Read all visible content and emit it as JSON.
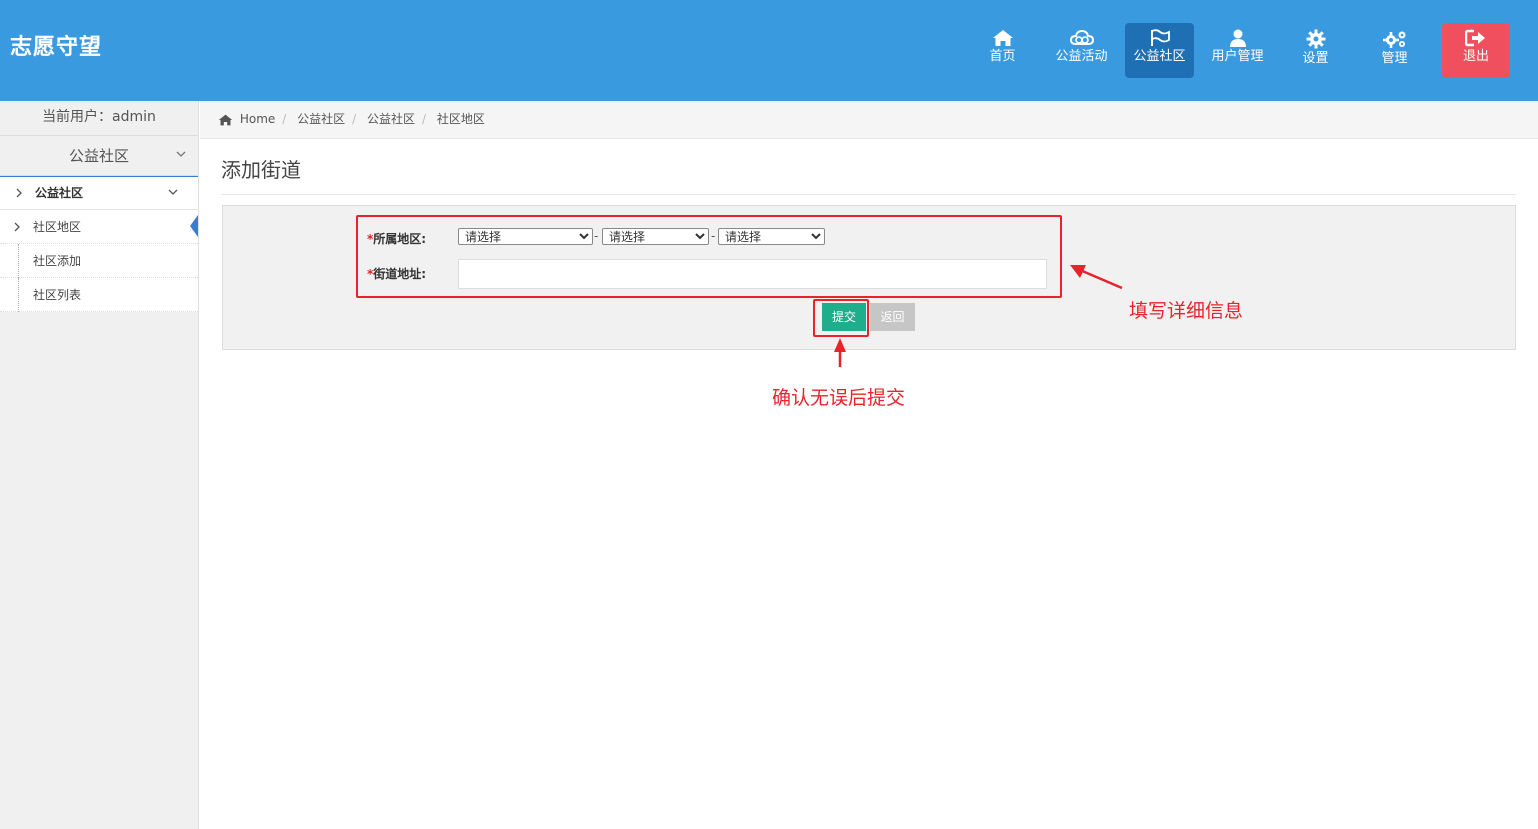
{
  "brand": "志愿守望",
  "nav": [
    {
      "label": "首页",
      "icon": "home-icon"
    },
    {
      "label": "公益活动",
      "icon": "cloud-icon"
    },
    {
      "label": "公益社区",
      "icon": "flag-icon",
      "active": true
    },
    {
      "label": "用户管理",
      "icon": "user-icon"
    },
    {
      "label": "设置",
      "icon": "gear-icon"
    },
    {
      "label": "管理",
      "icon": "gears-icon"
    },
    {
      "label": "退出",
      "icon": "logout-icon"
    }
  ],
  "sidebar": {
    "current_user": "当前用户：admin",
    "section_title": "公益社区",
    "menu_parent": "公益社区",
    "items": [
      {
        "label": "社区地区",
        "active": true
      },
      {
        "label": "社区添加"
      },
      {
        "label": "社区列表"
      }
    ]
  },
  "breadcrumb": [
    "Home",
    "公益社区",
    "公益社区",
    "社区地区"
  ],
  "page_title": "添加街道",
  "form": {
    "region_label": "所属地区:",
    "street_label": "街道地址:",
    "required_mark": "*",
    "selects": [
      "请选择",
      "请选择",
      "请选择"
    ],
    "separator": "-",
    "street_value": "",
    "submit": "提交",
    "back": "返回"
  },
  "annotations": {
    "fill_info": "填写详细信息",
    "confirm_submit": "确认无误后提交"
  },
  "colors": {
    "topbar": "#3a9ae0",
    "nav_active": "#1f6fb5",
    "logout": "#f0505d",
    "submit": "#1fae8c",
    "annotation": "#e8232b"
  }
}
